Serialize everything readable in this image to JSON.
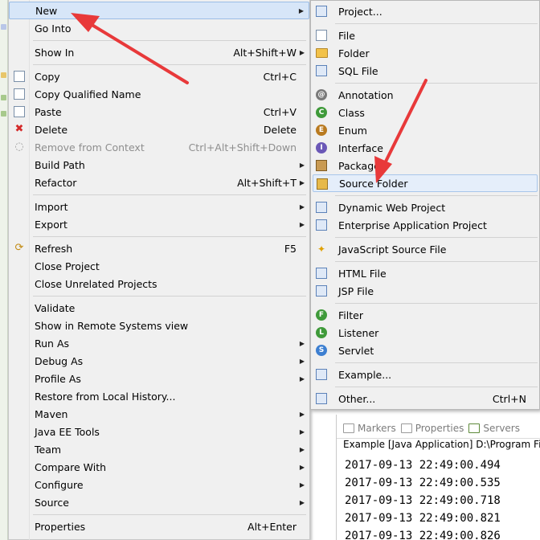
{
  "context_menu": {
    "items": [
      {
        "label": "New",
        "accel": "",
        "submenu": true,
        "icon": "",
        "highlighted": true
      },
      {
        "label": "Go Into",
        "accel": "",
        "submenu": false,
        "icon": ""
      },
      {
        "label": "Show In",
        "accel": "Alt+Shift+W",
        "submenu": true,
        "icon": ""
      },
      {
        "label": "Copy",
        "accel": "Ctrl+C",
        "submenu": false,
        "icon": "copy-icon"
      },
      {
        "label": "Copy Qualified Name",
        "accel": "",
        "submenu": false,
        "icon": "copy-qualified-name-icon"
      },
      {
        "label": "Paste",
        "accel": "Ctrl+V",
        "submenu": false,
        "icon": "paste-icon"
      },
      {
        "label": "Delete",
        "accel": "Delete",
        "submenu": false,
        "icon": "delete-icon"
      },
      {
        "label": "Remove from Context",
        "accel": "Ctrl+Alt+Shift+Down",
        "submenu": false,
        "icon": "remove-from-context-icon",
        "disabled": true
      },
      {
        "label": "Build Path",
        "accel": "",
        "submenu": true,
        "icon": ""
      },
      {
        "label": "Refactor",
        "accel": "Alt+Shift+T",
        "submenu": true,
        "icon": ""
      },
      {
        "label": "Import",
        "accel": "",
        "submenu": true,
        "icon": ""
      },
      {
        "label": "Export",
        "accel": "",
        "submenu": true,
        "icon": ""
      },
      {
        "label": "Refresh",
        "accel": "F5",
        "submenu": false,
        "icon": "refresh-icon"
      },
      {
        "label": "Close Project",
        "accel": "",
        "submenu": false,
        "icon": ""
      },
      {
        "label": "Close Unrelated Projects",
        "accel": "",
        "submenu": false,
        "icon": ""
      },
      {
        "label": "Validate",
        "accel": "",
        "submenu": false,
        "icon": ""
      },
      {
        "label": "Show in Remote Systems view",
        "accel": "",
        "submenu": false,
        "icon": ""
      },
      {
        "label": "Run As",
        "accel": "",
        "submenu": true,
        "icon": ""
      },
      {
        "label": "Debug As",
        "accel": "",
        "submenu": true,
        "icon": ""
      },
      {
        "label": "Profile As",
        "accel": "",
        "submenu": true,
        "icon": ""
      },
      {
        "label": "Restore from Local History...",
        "accel": "",
        "submenu": false,
        "icon": ""
      },
      {
        "label": "Maven",
        "accel": "",
        "submenu": true,
        "icon": ""
      },
      {
        "label": "Java EE Tools",
        "accel": "",
        "submenu": true,
        "icon": ""
      },
      {
        "label": "Team",
        "accel": "",
        "submenu": true,
        "icon": ""
      },
      {
        "label": "Compare With",
        "accel": "",
        "submenu": true,
        "icon": ""
      },
      {
        "label": "Configure",
        "accel": "",
        "submenu": true,
        "icon": ""
      },
      {
        "label": "Source",
        "accel": "",
        "submenu": true,
        "icon": ""
      },
      {
        "label": "Properties",
        "accel": "Alt+Enter",
        "submenu": false,
        "icon": ""
      }
    ]
  },
  "new_submenu": {
    "items": [
      {
        "label": "Project...",
        "accel": "",
        "icon": "project-icon"
      },
      {
        "label": "File",
        "accel": "",
        "icon": "file-icon"
      },
      {
        "label": "Folder",
        "accel": "",
        "icon": "folder-icon"
      },
      {
        "label": "SQL File",
        "accel": "",
        "icon": "sql-file-icon"
      },
      {
        "label": "Annotation",
        "accel": "",
        "icon": "annotation-icon"
      },
      {
        "label": "Class",
        "accel": "",
        "icon": "class-icon"
      },
      {
        "label": "Enum",
        "accel": "",
        "icon": "enum-icon"
      },
      {
        "label": "Interface",
        "accel": "",
        "icon": "interface-icon"
      },
      {
        "label": "Package",
        "accel": "",
        "icon": "package-icon"
      },
      {
        "label": "Source Folder",
        "accel": "",
        "icon": "source-folder-icon",
        "highlighted": true
      },
      {
        "label": "Dynamic Web Project",
        "accel": "",
        "icon": "dynamic-web-project-icon"
      },
      {
        "label": "Enterprise Application Project",
        "accel": "",
        "icon": "enterprise-application-project-icon"
      },
      {
        "label": "JavaScript Source File",
        "accel": "",
        "icon": "javascript-source-file-icon"
      },
      {
        "label": "HTML File",
        "accel": "",
        "icon": "html-file-icon"
      },
      {
        "label": "JSP File",
        "accel": "",
        "icon": "jsp-file-icon"
      },
      {
        "label": "Filter",
        "accel": "",
        "icon": "filter-icon"
      },
      {
        "label": "Listener",
        "accel": "",
        "icon": "listener-icon"
      },
      {
        "label": "Servlet",
        "accel": "",
        "icon": "servlet-icon"
      },
      {
        "label": "Example...",
        "accel": "",
        "icon": "example-icon"
      },
      {
        "label": "Other...",
        "accel": "Ctrl+N",
        "icon": "other-icon"
      }
    ]
  },
  "console_panel": {
    "tabs": [
      {
        "label": "Markers",
        "icon": "markers-icon"
      },
      {
        "label": "Properties",
        "icon": "properties-icon"
      },
      {
        "label": "Servers",
        "icon": "servers-icon"
      }
    ],
    "description": "Example [Java Application] D:\\Program File",
    "lines": [
      "2017-09-13 22:49:00.494",
      "2017-09-13 22:49:00.535",
      "2017-09-13 22:49:00.718",
      "2017-09-13 22:49:00.821",
      "2017-09-13 22:49:00.826"
    ]
  },
  "colors": {
    "menu_bg": "#f0f0f0",
    "highlight_bg": "#d7e6f8",
    "annotation_arrow": "#e8393a"
  }
}
